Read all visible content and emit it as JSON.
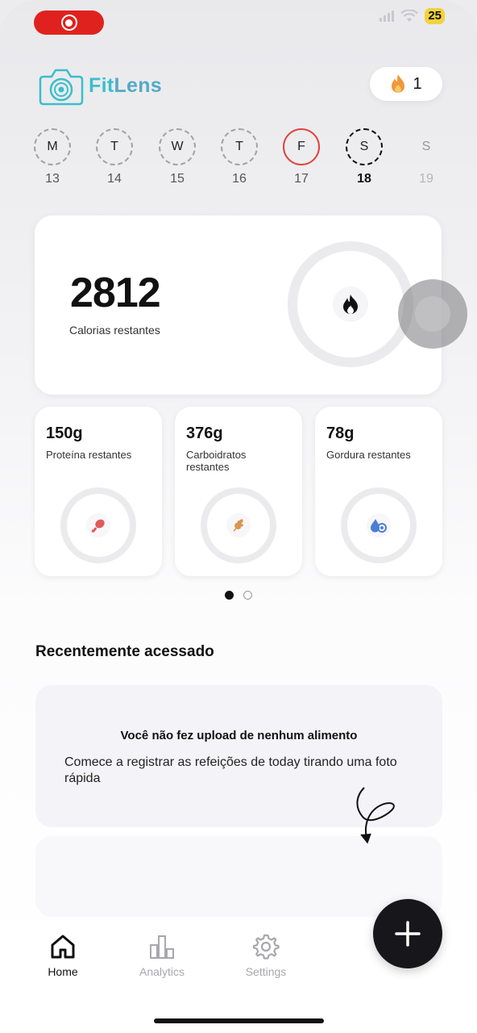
{
  "status_bar": {
    "battery": "25"
  },
  "header": {
    "brand_part1": "Fit",
    "brand_part2": "Lens",
    "streak_count": "1"
  },
  "week": [
    {
      "letter": "M",
      "date": "13",
      "state": "past"
    },
    {
      "letter": "T",
      "date": "14",
      "state": "past"
    },
    {
      "letter": "W",
      "date": "15",
      "state": "past"
    },
    {
      "letter": "T",
      "date": "16",
      "state": "past"
    },
    {
      "letter": "F",
      "date": "17",
      "state": "today"
    },
    {
      "letter": "S",
      "date": "18",
      "state": "selected"
    },
    {
      "letter": "S",
      "date": "19",
      "state": "future"
    }
  ],
  "calories": {
    "value": "2812",
    "label": "Calorias restantes",
    "progress": 0
  },
  "macros": [
    {
      "value": "150g",
      "label": "Proteína restantes",
      "icon": "drumstick-icon",
      "color": "#e25a5a"
    },
    {
      "value": "376g",
      "label": "Carboidratos restantes",
      "icon": "wheat-icon",
      "color": "#d8954a"
    },
    {
      "value": "78g",
      "label": "Gordura restantes",
      "icon": "fat-drop-icon",
      "color": "#4a7fd6"
    }
  ],
  "pager": {
    "pages": 2,
    "active": 0
  },
  "recent": {
    "title": "Recentemente acessado",
    "empty_title": "Você não fez upload de nenhum alimento",
    "empty_text": "Comece a registrar as refeições de today tirando uma foto rápida"
  },
  "tabs": [
    {
      "label": "Home",
      "icon": "home-icon",
      "active": true
    },
    {
      "label": "Analytics",
      "icon": "bar-chart-icon",
      "active": false
    },
    {
      "label": "Settings",
      "icon": "gear-icon",
      "active": false
    }
  ],
  "colors": {
    "accent_record": "#e0221e",
    "today_ring": "#e0433b",
    "brand_teal": "#3bbecb",
    "fab": "#17171b"
  }
}
